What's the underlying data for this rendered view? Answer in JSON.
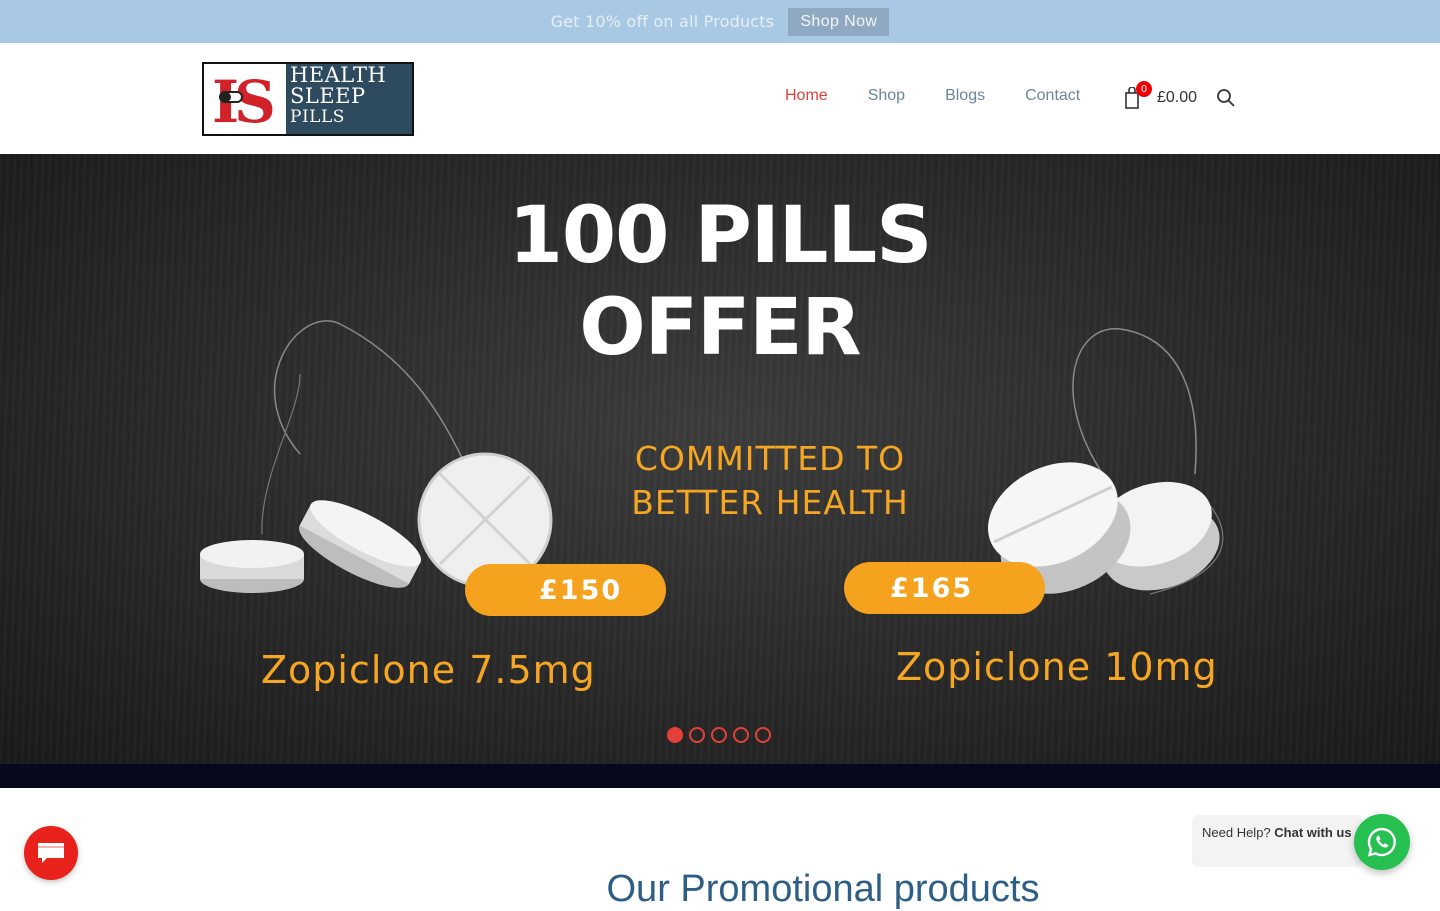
{
  "promo": {
    "text": "Get 10% off on all Products",
    "button_label": "Shop Now"
  },
  "logo": {
    "mark": "HS",
    "lines": [
      "HEALTH",
      "SLEEP",
      "PILLS"
    ]
  },
  "nav": {
    "items": [
      {
        "label": "Home",
        "active": true
      },
      {
        "label": "Shop",
        "active": false
      },
      {
        "label": "Blogs",
        "active": false
      },
      {
        "label": "Contact",
        "active": false
      }
    ]
  },
  "cart": {
    "count": "0",
    "total": "£0.00",
    "icon": "bag-icon"
  },
  "search": {
    "icon": "search-icon"
  },
  "hero": {
    "title_line1": "100 PILLS",
    "title_line2": "OFFER",
    "subtitle_line1": "COMMITTED TO",
    "subtitle_line2": "BETTER HEALTH",
    "products": [
      {
        "price": "£150",
        "name": "Zopiclone 7.5mg"
      },
      {
        "price": "£165",
        "name": "Zopiclone 10mg"
      }
    ],
    "slides": 5,
    "active_slide": 1
  },
  "section": {
    "title": "Our Promotional products"
  },
  "help": {
    "prefix": "Need Help?",
    "bold": "Chat with us"
  },
  "colors": {
    "promo_bg": "#a8c8e4",
    "nav_active": "#e4403a",
    "accent_orange": "#f5a623",
    "whatsapp": "#25c050",
    "chat_red": "#e8221a"
  }
}
